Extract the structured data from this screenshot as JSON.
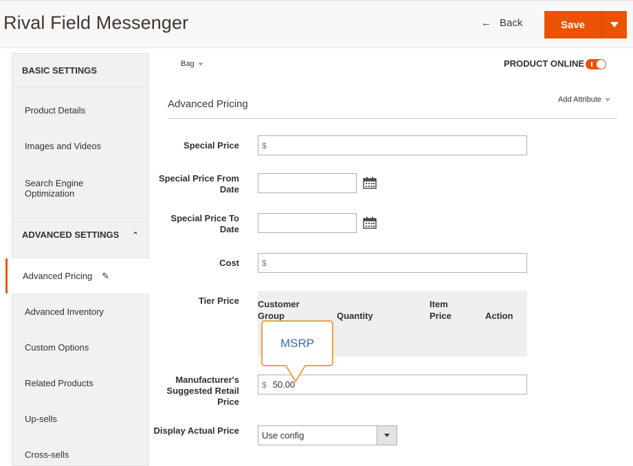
{
  "header": {
    "title": "Rival Field Messenger",
    "back_label": "Back",
    "save_label": "Save"
  },
  "sidebar": {
    "basic_title": "BASIC SETTINGS",
    "basic_items": [
      {
        "label": "Product Details"
      },
      {
        "label": "Images and Videos"
      },
      {
        "label": "Search Engine Optimization"
      }
    ],
    "advanced_title": "ADVANCED SETTINGS",
    "advanced_items": [
      {
        "label": "Advanced Pricing"
      },
      {
        "label": "Advanced Inventory"
      },
      {
        "label": "Custom Options"
      },
      {
        "label": "Related Products"
      },
      {
        "label": "Up-sells"
      },
      {
        "label": "Cross-sells"
      }
    ]
  },
  "main": {
    "attribute_set": "Bag",
    "product_online_label": "PRODUCT ONLINE",
    "product_online": true,
    "section_title": "Advanced Pricing",
    "add_attribute": "Add Attribute",
    "fields": {
      "special_price": {
        "label": "Special Price",
        "prefix": "$",
        "value": ""
      },
      "special_from": {
        "label": "Special Price From Date",
        "value": ""
      },
      "special_to": {
        "label": "Special Price To Date",
        "value": ""
      },
      "cost": {
        "label": "Cost",
        "prefix": "$",
        "value": ""
      },
      "tier_price": {
        "label": "Tier Price"
      },
      "msrp": {
        "label": "Manufacturer's Suggested Retail Price",
        "prefix": "$",
        "value": "50.00"
      },
      "display_actual": {
        "label": "Display Actual Price",
        "value": "Use config"
      }
    },
    "tier_table": {
      "headers": [
        "Customer Group",
        "Quantity",
        "Item Price",
        "Action"
      ]
    }
  },
  "callout": {
    "text": "MSRP"
  },
  "colors": {
    "accent": "#eb5202",
    "callout_border": "#f0a040",
    "callout_text": "#3d66b0"
  },
  "icons": {
    "back": "arrow-left-icon",
    "save_dropdown": "chevron-down-icon",
    "edit": "pencil-icon",
    "collapse": "chevron-up-icon",
    "date": "calendar-icon"
  }
}
